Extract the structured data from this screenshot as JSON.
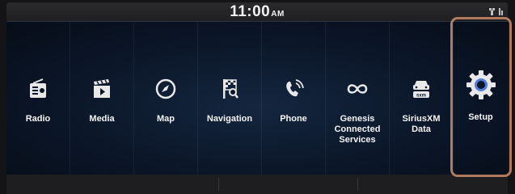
{
  "status": {
    "time": "11:00",
    "ampm": "AM"
  },
  "apps": [
    {
      "label": "Radio",
      "icon": "radio-icon"
    },
    {
      "label": "Media",
      "icon": "media-icon"
    },
    {
      "label": "Map",
      "icon": "compass-icon"
    },
    {
      "label": "Navigation",
      "icon": "navigation-flag-icon"
    },
    {
      "label": "Phone",
      "icon": "phone-icon"
    },
    {
      "label": "Genesis\nConnected\nServices",
      "icon": "infinity-icon"
    },
    {
      "label": "SiriusXM\nData",
      "icon": "siriusxm-icon"
    },
    {
      "label": "Setup",
      "icon": "gear-icon"
    }
  ],
  "siriusxm_badge": "sxm",
  "colors": {
    "highlight": "#b07a5e",
    "accent": "#4f7fd6"
  }
}
